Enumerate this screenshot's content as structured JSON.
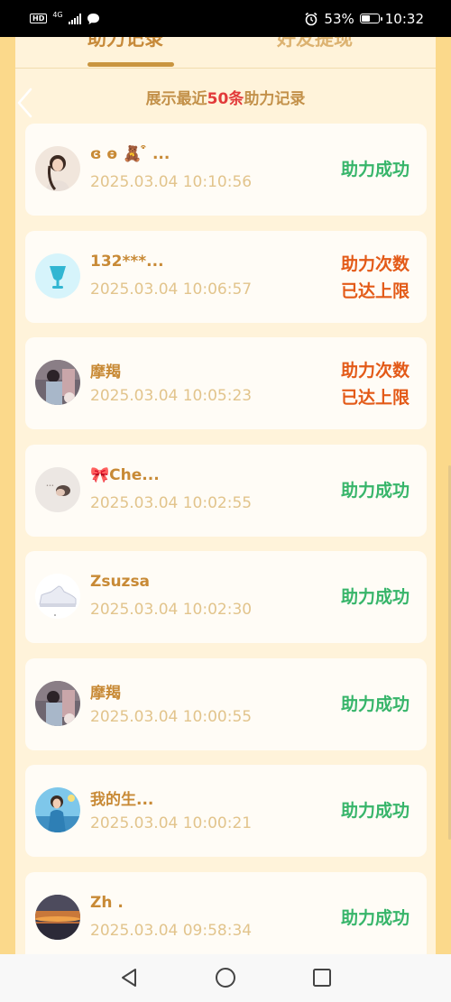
{
  "status_bar": {
    "network": "4G",
    "battery": "53%",
    "battery_level": 0.53,
    "time": "10:32"
  },
  "tabs": [
    {
      "label": "助力记录",
      "active": true
    },
    {
      "label": "好友提现",
      "active": false
    }
  ],
  "subtitle": {
    "prefix": "展示最近",
    "count": "50条",
    "suffix": "助力记录"
  },
  "records": [
    {
      "name": "ɞ ɵ 🧸 ͒ ...",
      "time": "2025.03.04 10:10:56",
      "status_lines": [
        "助力成功"
      ],
      "status_type": "success",
      "avatar": "portrait"
    },
    {
      "name": "132***...",
      "time": "2025.03.04 10:06:57",
      "status_lines": [
        "助力次数",
        "已达上限"
      ],
      "status_type": "limit",
      "avatar": "cup"
    },
    {
      "name": "摩羯",
      "time": "2025.03.04 10:05:23",
      "status_lines": [
        "助力次数",
        "已达上限"
      ],
      "status_type": "limit",
      "avatar": "photo"
    },
    {
      "name": "🎀Che...",
      "time": "2025.03.04 10:02:55",
      "status_lines": [
        "助力成功"
      ],
      "status_type": "success",
      "avatar": "grey"
    },
    {
      "name": "Zsuzsa",
      "time": "2025.03.04 10:02:30",
      "status_lines": [
        "助力成功"
      ],
      "status_type": "success",
      "avatar": "shoe"
    },
    {
      "name": "摩羯",
      "time": "2025.03.04 10:00:55",
      "status_lines": [
        "助力成功"
      ],
      "status_type": "success",
      "avatar": "photo"
    },
    {
      "name": "我的生...",
      "time": "2025.03.04 10:00:21",
      "status_lines": [
        "助力成功"
      ],
      "status_type": "success",
      "avatar": "beach"
    },
    {
      "name": "Zh .",
      "time": "2025.03.04 09:58:34",
      "status_lines": [
        "助力成功"
      ],
      "status_type": "success",
      "avatar": "sunset"
    }
  ],
  "colors": {
    "success": "#37b56a",
    "limit": "#e35a18",
    "accent": "#c99540",
    "count_highlight": "#e23a3a"
  },
  "icons": {
    "back": "chevron-left-icon",
    "nav_back": "triangle-back-icon",
    "nav_home": "circle-home-icon",
    "nav_recent": "square-recent-icon"
  }
}
